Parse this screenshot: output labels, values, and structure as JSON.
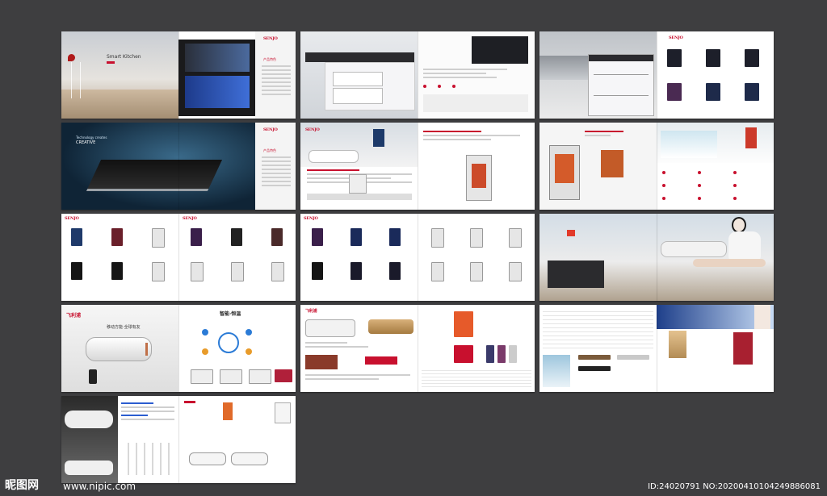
{
  "brand": {
    "name": "SENJO",
    "accent": "#c8102e",
    "background": "#3e3e40"
  },
  "spreads": [
    {
      "id": "smart-kitchen",
      "title": "Smart Kitchen",
      "subtitle": "SENJO",
      "section": "产品特色"
    },
    {
      "id": "kitchen-island",
      "title": "",
      "subtitle": "",
      "section": ""
    },
    {
      "id": "city-cabinet",
      "title": "",
      "subtitle": "",
      "section": ""
    },
    {
      "id": "induction-cooker",
      "title": "Technology creates",
      "subtitle": "CREATIVE",
      "section": "产品特色"
    },
    {
      "id": "bathroom-heater",
      "title": "",
      "subtitle": "",
      "section": ""
    },
    {
      "id": "heater-tech",
      "title": "",
      "subtitle": "",
      "section": ""
    },
    {
      "id": "gas-heaters-1",
      "title": "",
      "subtitle": "",
      "section": ""
    },
    {
      "id": "gas-heaters-2",
      "title": "",
      "subtitle": "",
      "section": ""
    },
    {
      "id": "bath-woman",
      "title": "",
      "subtitle": "",
      "section": ""
    },
    {
      "id": "smart-constant",
      "title": "飞利浦",
      "subtitle": "移动方能·全球有友",
      "section": "智能·恒温"
    },
    {
      "id": "electric-heaters",
      "title": "",
      "subtitle": "",
      "section": ""
    },
    {
      "id": "instant-heaters",
      "title": "",
      "subtitle": "",
      "section": ""
    },
    {
      "id": "storage-heaters",
      "title": "",
      "subtitle": "",
      "section": ""
    }
  ],
  "watermark": {
    "logo": "昵图网",
    "url": "www.nipic.com",
    "id_text": "ID:24020791 NO:20200410104249886081"
  }
}
